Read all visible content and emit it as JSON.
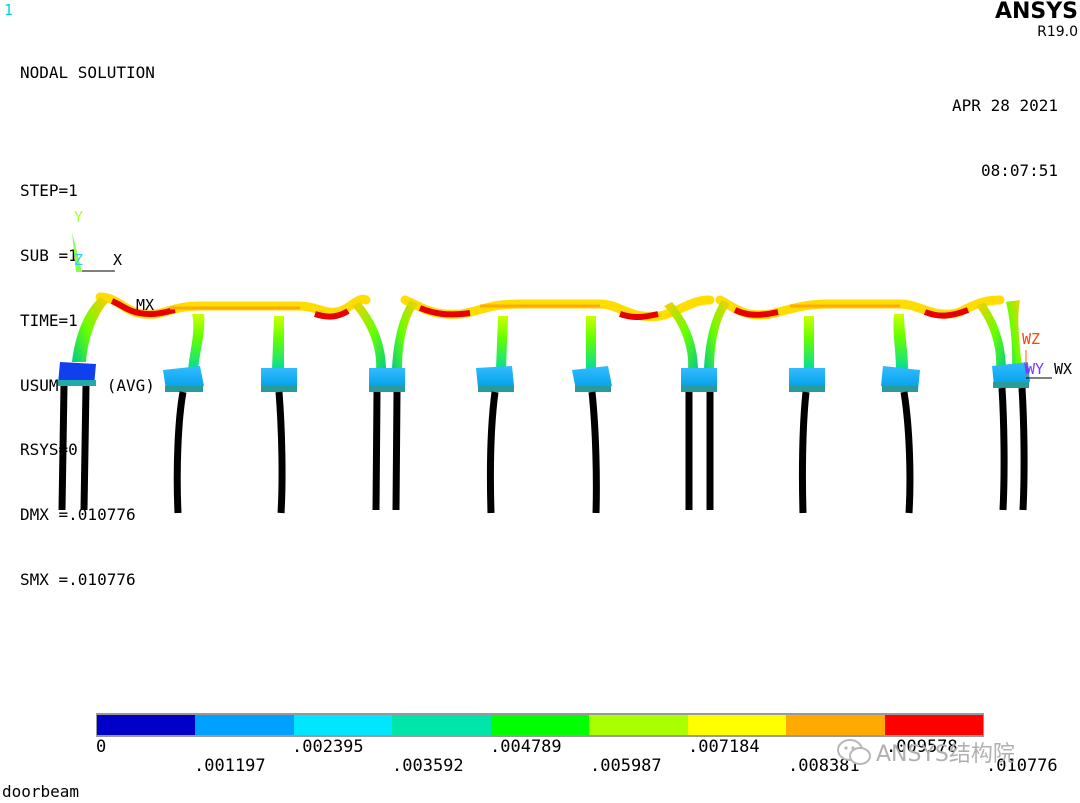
{
  "window_number": "1",
  "info": {
    "title": "NODAL SOLUTION",
    "step": "STEP=1",
    "sub": "SUB =1",
    "time": "TIME=1",
    "usum": "USUM     (AVG)",
    "rsys": "RSYS=0",
    "dmx": "DMX =.010776",
    "smx": "SMX =.010776"
  },
  "brand": {
    "name": "ANSYS",
    "version": "R19.0"
  },
  "datetime": {
    "date": "APR 28 2021",
    "time": "08:07:51"
  },
  "triad": {
    "y": "Y",
    "z": "Z",
    "x": "X"
  },
  "working_plane": {
    "wz": "WZ",
    "wy": "WY",
    "wx": "WX"
  },
  "mx_label": "MX",
  "legend": {
    "colors": [
      "#0000c8",
      "#00a0ff",
      "#00e6ff",
      "#00e6aa",
      "#00ff00",
      "#aaff00",
      "#ffff00",
      "#ffaa00",
      "#ff0000"
    ],
    "upper_ticks": [
      "0",
      ".002395",
      ".004789",
      ".007184",
      ".009578"
    ],
    "lower_ticks": [
      ".001197",
      ".003592",
      ".005987",
      ".008381",
      ".010776"
    ]
  },
  "jobname": "doorbeam",
  "watermark": "ANSYS结构院"
}
